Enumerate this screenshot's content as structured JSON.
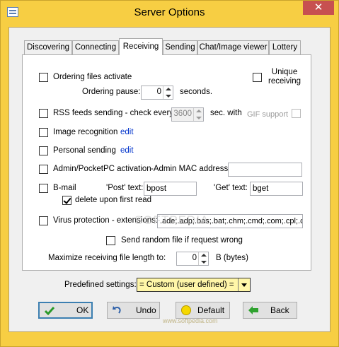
{
  "window": {
    "title": "Server Options",
    "close_glyph": "✕"
  },
  "tabs": [
    {
      "label": "Discovering"
    },
    {
      "label": "Connecting"
    },
    {
      "label": "Receiving",
      "active": true
    },
    {
      "label": "Sending"
    },
    {
      "label": "Chat/Image viewer"
    },
    {
      "label": "Lottery"
    }
  ],
  "receiving": {
    "ordering_files": {
      "label": "Ordering files activate",
      "checked": false
    },
    "unique_receiving": {
      "label_line1": "Unique",
      "label_line2": "receiving",
      "checked": false
    },
    "ordering_pause": {
      "label": "Ordering pause:",
      "value": "0",
      "unit": "seconds."
    },
    "rss": {
      "label": "RSS feeds sending - check every:",
      "value": "3600",
      "unit": "sec. with",
      "gif_label": "GIF support",
      "checked": false,
      "gif_checked": false
    },
    "image_recognition": {
      "label": "Image recognition",
      "link": "edit",
      "checked": false
    },
    "personal_sending": {
      "label": "Personal sending",
      "link": "edit",
      "checked": false
    },
    "admin": {
      "label": "Admin/PocketPC activation",
      "mac_label": "-Admin MAC address:",
      "mac_value": "",
      "checked": false
    },
    "bmail": {
      "label": "B-mail",
      "post_label": "'Post' text:",
      "post_value": "bpost",
      "get_label": "'Get' text:",
      "get_value": "bget",
      "checked": false
    },
    "delete_first_read": {
      "label": "delete upon first read",
      "checked": true
    },
    "virus": {
      "label": "Virus protection - extensions:",
      "value": ".ade;.adp;.bas;.bat;.chm;.cmd;.com;.cpl;.cr",
      "checked": false
    },
    "send_random": {
      "label": "Send random file if request wrong",
      "checked": false
    },
    "max_length": {
      "label": "Maximize receiving file length to:",
      "value": "0",
      "unit": "B (bytes)"
    }
  },
  "predefined": {
    "label": "Predefined settings:",
    "selected": "= Custom (user defined) ="
  },
  "buttons": {
    "ok": "OK",
    "undo": "Undo",
    "default": "Default",
    "back": "Back"
  },
  "colors": {
    "window_frame": "#f7ce43",
    "client": "#f0f0f0",
    "close": "#c75050",
    "link": "#0033cc",
    "select_bg": "#fff6a8",
    "default_border": "#3c7fb1"
  },
  "watermark": {
    "main": "SOFTPEDIA",
    "small": "www.softpedia.com"
  }
}
